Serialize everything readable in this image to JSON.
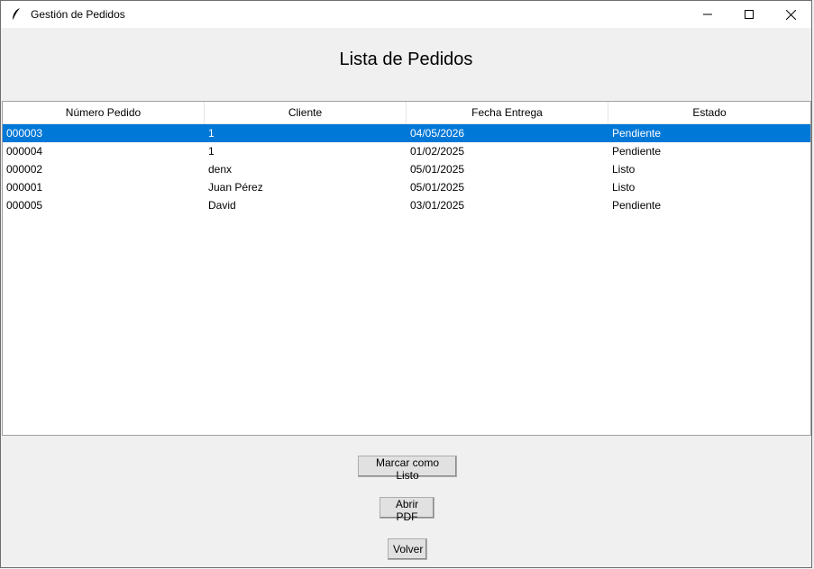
{
  "window": {
    "title": "Gestión de Pedidos",
    "icon": "feather-icon",
    "controls": [
      "minimize-icon",
      "maximize-icon",
      "close-icon"
    ]
  },
  "page": {
    "heading": "Lista de Pedidos"
  },
  "table": {
    "columns": [
      "Número Pedido",
      "Cliente",
      "Fecha Entrega",
      "Estado"
    ],
    "rows": [
      {
        "numero": "000003",
        "cliente": "1",
        "fecha": "04/05/2026",
        "estado": "Pendiente",
        "selected": true
      },
      {
        "numero": "000004",
        "cliente": "1",
        "fecha": "01/02/2025",
        "estado": "Pendiente",
        "selected": false
      },
      {
        "numero": "000002",
        "cliente": "denx",
        "fecha": "05/01/2025",
        "estado": "Listo",
        "selected": false
      },
      {
        "numero": "000001",
        "cliente": "Juan Pérez",
        "fecha": "05/01/2025",
        "estado": "Listo",
        "selected": false
      },
      {
        "numero": "000005",
        "cliente": "David",
        "fecha": "03/01/2025",
        "estado": "Pendiente",
        "selected": false
      }
    ],
    "selection_color": "#0078d7"
  },
  "buttons": {
    "mark_ready": "Marcar como Listo",
    "open_pdf": "Abrir PDF",
    "back": "Volver"
  }
}
